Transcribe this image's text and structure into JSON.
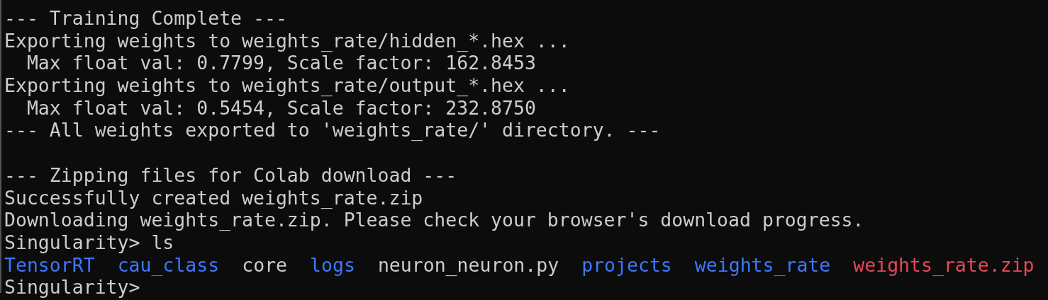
{
  "terminal": {
    "lines": [
      {
        "kind": "output",
        "text": "--- Training Complete ---"
      },
      {
        "kind": "output",
        "text": "Exporting weights to weights_rate/hidden_*.hex ..."
      },
      {
        "kind": "output",
        "text": "  Max float val: 0.7799, Scale factor: 162.8453"
      },
      {
        "kind": "output",
        "text": "Exporting weights to weights_rate/output_*.hex ..."
      },
      {
        "kind": "output",
        "text": "  Max float val: 0.5454, Scale factor: 232.8750"
      },
      {
        "kind": "output",
        "text": "--- All weights exported to 'weights_rate/' directory. ---"
      },
      {
        "kind": "blank"
      },
      {
        "kind": "output",
        "text": "--- Zipping files for Colab download ---"
      },
      {
        "kind": "output",
        "text": "Successfully created weights_rate.zip"
      },
      {
        "kind": "output",
        "text": "Downloading weights_rate.zip. Please check your browser's download progress."
      },
      {
        "kind": "command",
        "text": "Singularity> ls"
      },
      {
        "kind": "listing",
        "entries": [
          {
            "name": "TensorRT",
            "color": "#3b78ff"
          },
          {
            "name": "cau_class",
            "color": "#3b78ff"
          },
          {
            "name": "core",
            "color": "#cccccc"
          },
          {
            "name": "logs",
            "color": "#3b78ff"
          },
          {
            "name": "neuron_neuron.py",
            "color": "#cccccc"
          },
          {
            "name": "projects",
            "color": "#3b78ff"
          },
          {
            "name": "weights_rate",
            "color": "#3b78ff"
          },
          {
            "name": "weights_rate.zip",
            "color": "#e74856"
          }
        ]
      },
      {
        "kind": "command",
        "text": "Singularity>"
      }
    ]
  }
}
